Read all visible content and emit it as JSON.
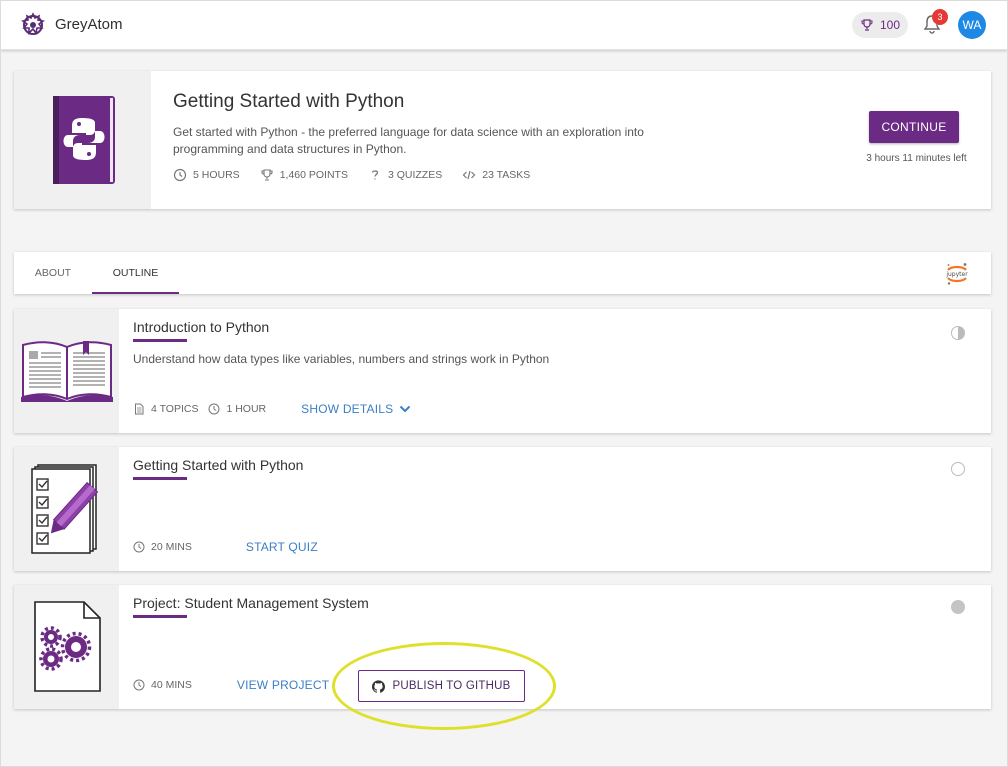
{
  "topbar": {
    "brand": "GreyAtom",
    "points": "100",
    "notification_count": "3",
    "avatar_initials": "WA"
  },
  "course": {
    "title": "Getting Started with Python",
    "description": "Get started with Python - the preferred language for data science with an exploration into programming and data structures in Python.",
    "stats": {
      "hours": "5 HOURS",
      "points": "1,460 POINTS",
      "quizzes": "3 QUIZZES",
      "tasks": "23 TASKS"
    },
    "continue_label": "CONTINUE",
    "time_left": "3 hours 11 minutes left"
  },
  "tabs": [
    {
      "label": "ABOUT"
    },
    {
      "label": "OUTLINE"
    }
  ],
  "modules": [
    {
      "title": "Introduction to Python",
      "description": "Understand how data types like variables, numbers and strings work in Python",
      "topics": "4 TOPICS",
      "duration": "1 HOUR",
      "action": "SHOW DETAILS"
    },
    {
      "title": "Getting Started with Python",
      "duration": "20 MINS",
      "action": "START QUIZ"
    },
    {
      "title": "Project: Student Management System",
      "duration": "40 MINS",
      "action": "VIEW PROJECT",
      "publish_label": "PUBLISH TO GITHUB"
    }
  ],
  "colors": {
    "accent": "#6b2a84",
    "link": "#3b7fc4",
    "badge": "#e53935",
    "avatar": "#1e88e5",
    "highlight": "#dfe02a"
  },
  "icons": [
    "greyatom-logo-icon",
    "trophy-icon",
    "bell-icon",
    "python-book-icon",
    "clock-icon",
    "quiz-icon",
    "code-icon",
    "jupyter-icon",
    "open-book-icon",
    "document-icon",
    "checklist-icon",
    "gears-document-icon",
    "github-icon",
    "chevron-down-icon"
  ]
}
